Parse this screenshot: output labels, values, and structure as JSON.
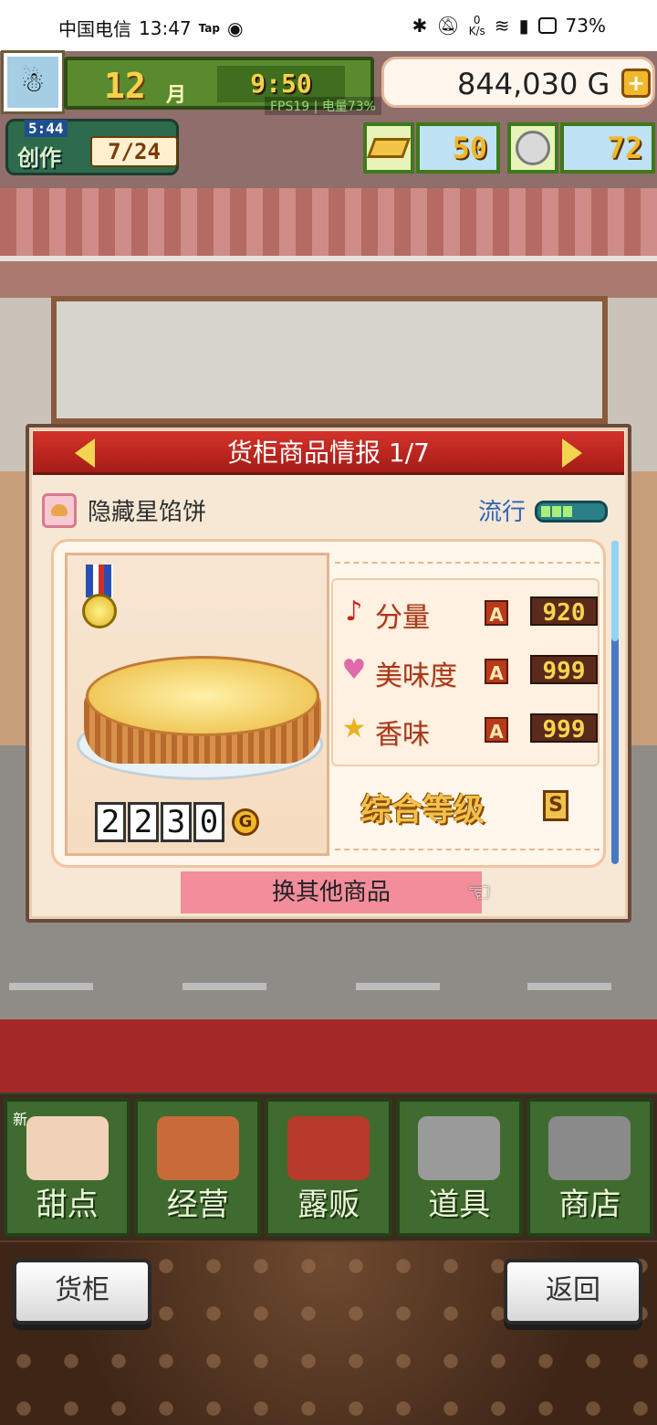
{
  "status_bar": {
    "carrier": "中国电信",
    "time": "13:47",
    "tap_label": "Tap",
    "net_rate_value": "0",
    "net_rate_unit": "K/s",
    "battery": "73%"
  },
  "hud": {
    "month": "12",
    "month_unit": "月",
    "clock": "9:50",
    "fps_text": "FPS19 | 电量73%",
    "gold": "844,030 G",
    "plus": "+",
    "create_timer": "5:44",
    "create_label": "创作",
    "create_count": "7/24",
    "resource_1_value": "50",
    "resource_2_value": "72"
  },
  "panel": {
    "title": "货柜商品情报 1/7",
    "item_name": "隐藏星馅饼",
    "trend_label": "流行",
    "trend_level_fraction": 0.6,
    "price_digits": [
      "2",
      "2",
      "3",
      "0"
    ],
    "price_unit": "G",
    "stats": [
      {
        "label": "分量",
        "grade": "A",
        "value": "920",
        "icon": "music-note-icon",
        "icon_color": "#d02020"
      },
      {
        "label": "美味度",
        "grade": "A",
        "value": "999",
        "icon": "heart-icon",
        "icon_color": "#e06aa8"
      },
      {
        "label": "香味",
        "grade": "A",
        "value": "999",
        "icon": "star-icon",
        "icon_color": "#e8b21e"
      }
    ],
    "overall_label": "综合等级",
    "overall_grade": "S",
    "swap_button": "换其他商品"
  },
  "menu": {
    "new_badge": "新",
    "items": [
      {
        "label": "甜点",
        "icon": "cake-icon"
      },
      {
        "label": "经营",
        "icon": "shop-icon"
      },
      {
        "label": "露贩",
        "icon": "truck-icon"
      },
      {
        "label": "道具",
        "icon": "gear-bag-icon"
      },
      {
        "label": "商店",
        "icon": "cart-icon"
      }
    ]
  },
  "buttons": {
    "counter": "货柜",
    "back": "返回"
  },
  "colors": {
    "header_red": "#c22a22",
    "menu_green": "#3f6b2e",
    "gold_yellow": "#f0b92a"
  }
}
